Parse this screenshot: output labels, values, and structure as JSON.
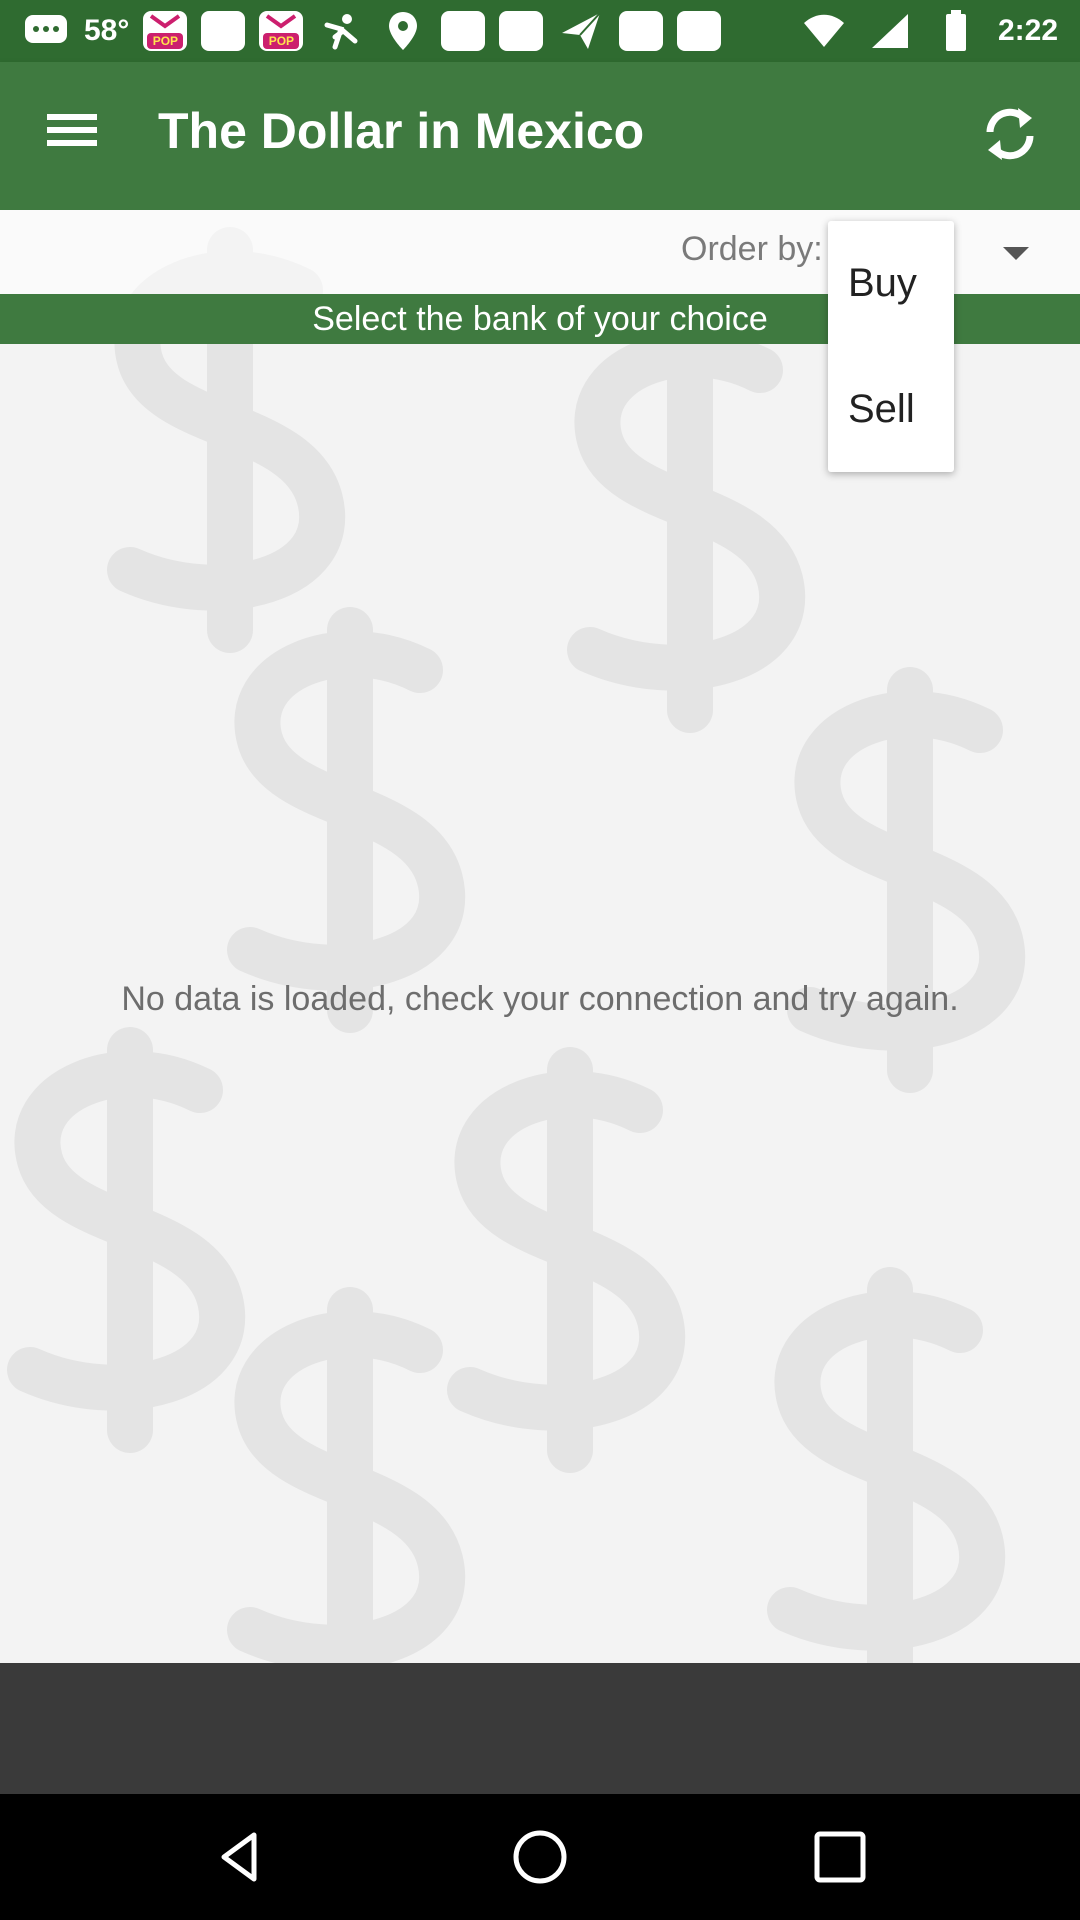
{
  "status_bar": {
    "temperature": "58°",
    "pop_badge": "POP",
    "time": "2:22",
    "icons": [
      "chat-bubble-icon",
      "pop-app-icon",
      "notification-box-icon",
      "pop-app-icon",
      "person-icon",
      "location-icon",
      "notification-box-icon",
      "notification-box-icon",
      "send-icon",
      "notification-box-icon",
      "notification-box-icon",
      "wifi-icon",
      "signal-icon",
      "battery-icon"
    ]
  },
  "app_bar": {
    "title": "The Dollar in Mexico",
    "menu_icon": "hamburger-menu-icon",
    "refresh_icon": "refresh-icon"
  },
  "order": {
    "label": "Order by:"
  },
  "bank_bar": {
    "label": "Select the bank of your choice"
  },
  "dropdown": {
    "options": [
      "Buy",
      "Sell"
    ]
  },
  "message": {
    "empty": "No data is loaded, check your connection and try again."
  },
  "nav_bar": {
    "icons": [
      "back-icon",
      "home-icon",
      "recents-icon"
    ]
  },
  "colors": {
    "status_bar": "#2f6b30",
    "app_bar": "#3f7a40",
    "bottom_band": "#3a3a3a",
    "nav_bar": "#000000"
  }
}
